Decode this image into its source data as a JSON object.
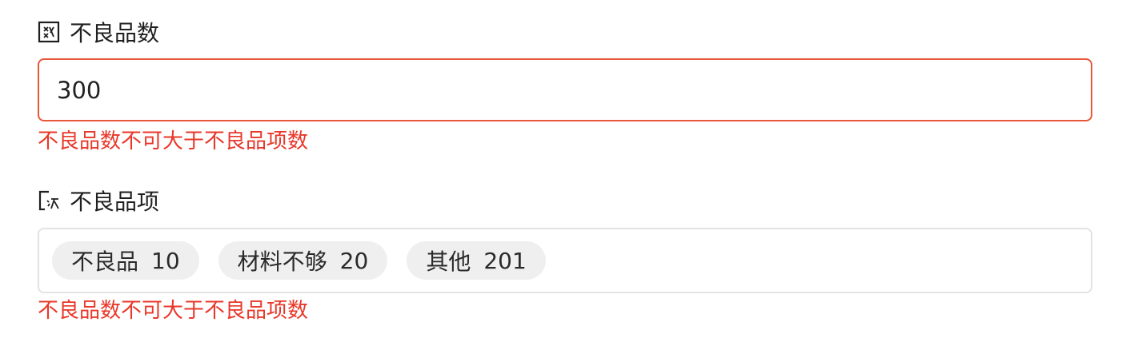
{
  "fields": [
    {
      "label": "不良品数",
      "icon": "number-field-icon",
      "value": "300",
      "error": "不良品数不可大于不良品项数"
    },
    {
      "label": "不良品项",
      "icon": "multi-select-icon",
      "tags": [
        {
          "name": "不良品",
          "count": "10"
        },
        {
          "name": "材料不够",
          "count": "20"
        },
        {
          "name": "其他",
          "count": "201"
        }
      ],
      "error": "不良品数不可大于不良品项数"
    }
  ],
  "colors": {
    "error": "#e8382a",
    "error_border": "#e8573a",
    "tag_bg": "#efefef",
    "input_border": "#e3e3e3"
  }
}
